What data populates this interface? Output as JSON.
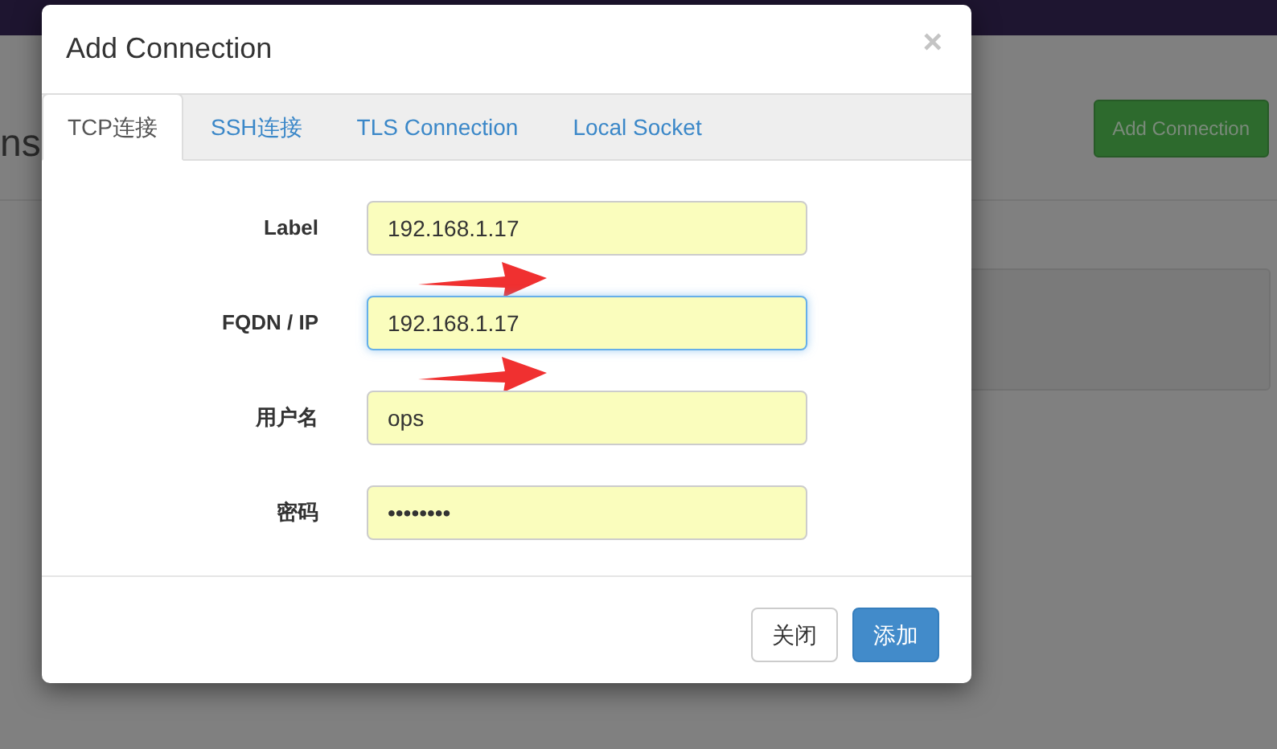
{
  "page": {
    "heading": "ns",
    "add_button": "Add Connection"
  },
  "modal": {
    "title": "Add Connection",
    "close": "×",
    "tabs": [
      {
        "label": "TCP连接",
        "selected": true
      },
      {
        "label": "SSH连接",
        "selected": false
      },
      {
        "label": "TLS Connection",
        "selected": false
      },
      {
        "label": "Local Socket",
        "selected": false
      }
    ],
    "fields": [
      {
        "label": "Label",
        "value": "192.168.1.17",
        "focused": false,
        "arrow": true
      },
      {
        "label": "FQDN / IP",
        "value": "192.168.1.17",
        "focused": true,
        "arrow": true
      },
      {
        "label": "用户名",
        "value": "ops",
        "focused": false,
        "arrow": false
      },
      {
        "label": "密码",
        "value": "••••••••",
        "focused": false,
        "arrow": false
      }
    ],
    "buttons": [
      {
        "label": "关闭",
        "kind": "default"
      },
      {
        "label": "添加",
        "kind": "primary"
      }
    ]
  }
}
